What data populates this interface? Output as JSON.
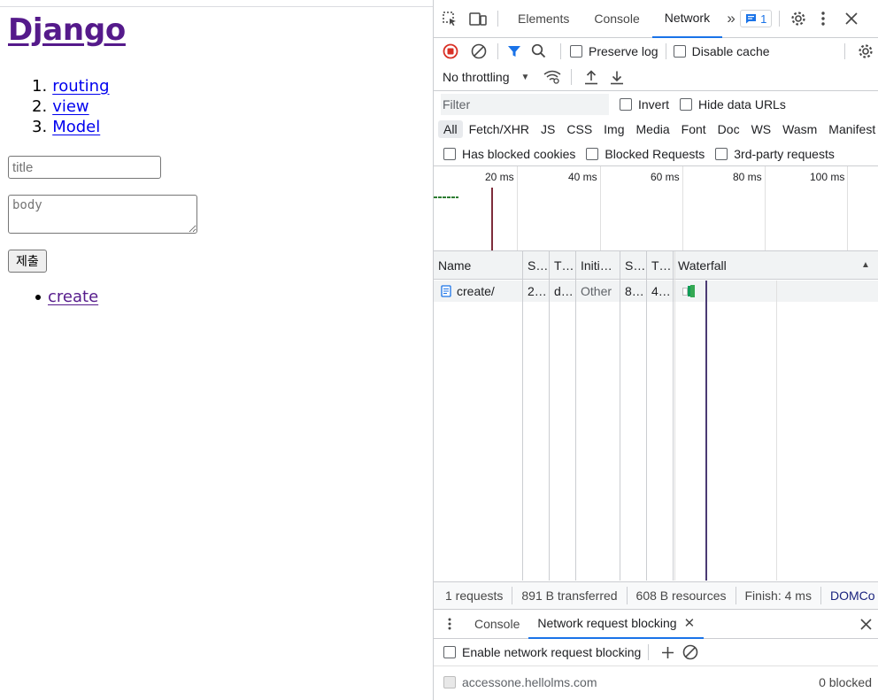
{
  "page": {
    "title": "Django",
    "nav": [
      {
        "num": "1.",
        "label": "routing"
      },
      {
        "num": "2.",
        "label": "view"
      },
      {
        "num": "3.",
        "label": "Model"
      }
    ],
    "title_placeholder": "title",
    "body_placeholder": "body",
    "submit_label": "제출",
    "links": [
      {
        "label": "create"
      }
    ]
  },
  "devtools": {
    "tabs": [
      "Elements",
      "Console",
      "Network"
    ],
    "active_tab": "Network",
    "message_count": "1",
    "toolbar": {
      "preserve_log": "Preserve log",
      "disable_cache": "Disable cache",
      "throttling": "No throttling"
    },
    "filter": {
      "placeholder": "Filter",
      "invert": "Invert",
      "hide_data_urls": "Hide data URLs"
    },
    "types": [
      "All",
      "Fetch/XHR",
      "JS",
      "CSS",
      "Img",
      "Media",
      "Font",
      "Doc",
      "WS",
      "Wasm",
      "Manifest"
    ],
    "blocked": {
      "has_blocked_cookies": "Has blocked cookies",
      "blocked_requests": "Blocked Requests",
      "third_party": "3rd-party requests"
    },
    "overview_ticks": [
      "20 ms",
      "40 ms",
      "60 ms",
      "80 ms",
      "100 ms"
    ],
    "columns": [
      "Name",
      "S…",
      "T…",
      "Initi…",
      "S…",
      "T…",
      "Waterfall"
    ],
    "requests": [
      {
        "name": "create/",
        "status": "2…",
        "type": "d…",
        "initiator": "Other",
        "size": "8…",
        "time": "4…"
      }
    ],
    "summary": {
      "requests": "1 requests",
      "transferred": "891 B transferred",
      "resources": "608 B resources",
      "finish": "Finish: 4 ms",
      "domcontent": "DOMCo"
    },
    "drawer": {
      "tabs": [
        "Console",
        "Network request blocking"
      ],
      "enable_label": "Enable network request blocking",
      "pattern": "accessone.hellolms.com",
      "pattern_status": "0 blocked"
    },
    "colors": {
      "accent": "#1a73e8",
      "record": "#d93025",
      "visited": "#551a8b"
    }
  }
}
